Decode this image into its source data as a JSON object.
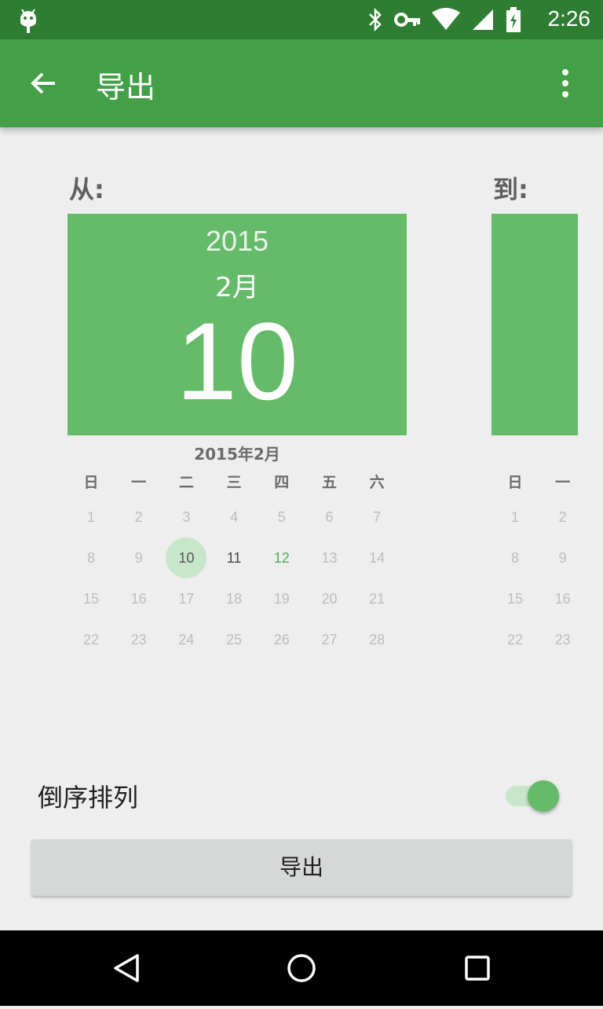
{
  "status_bar": {
    "time": "2:26",
    "icons": [
      "android-icon",
      "bluetooth-icon",
      "vpn-key-icon",
      "wifi-icon",
      "cell-signal-icon",
      "battery-charging-icon"
    ]
  },
  "app_bar": {
    "title": "导出",
    "back_icon": "arrow-back-icon",
    "menu_icon": "more-vert-icon"
  },
  "from_label": "从:",
  "to_label": "到:",
  "from_calendar": {
    "year": "2015",
    "month": "2月",
    "day": "10",
    "month_title": "2015年2月",
    "weekdays": [
      "日",
      "一",
      "二",
      "三",
      "四",
      "五",
      "六"
    ],
    "weeks": [
      [
        "1",
        "2",
        "3",
        "4",
        "5",
        "6",
        "7"
      ],
      [
        "8",
        "9",
        "10",
        "11",
        "12",
        "13",
        "14"
      ],
      [
        "15",
        "16",
        "17",
        "18",
        "19",
        "20",
        "21"
      ],
      [
        "22",
        "23",
        "24",
        "25",
        "26",
        "27",
        "28"
      ]
    ],
    "selected_day": "10",
    "today": "12"
  },
  "to_calendar": {
    "weekdays": [
      "日",
      "一"
    ],
    "weeks": [
      [
        "1",
        "2"
      ],
      [
        "8",
        "9"
      ],
      [
        "15",
        "16"
      ],
      [
        "22",
        "23"
      ]
    ]
  },
  "sort_label": "倒序排列",
  "sort_enabled": true,
  "export_button": "导出",
  "colors": {
    "status_bar": "#2e7d32",
    "app_bar": "#43a047",
    "calendar_header": "#66bb6a",
    "selected_circle": "#c8e6c9",
    "today_text": "#4caf50",
    "background": "#eeeeee"
  }
}
